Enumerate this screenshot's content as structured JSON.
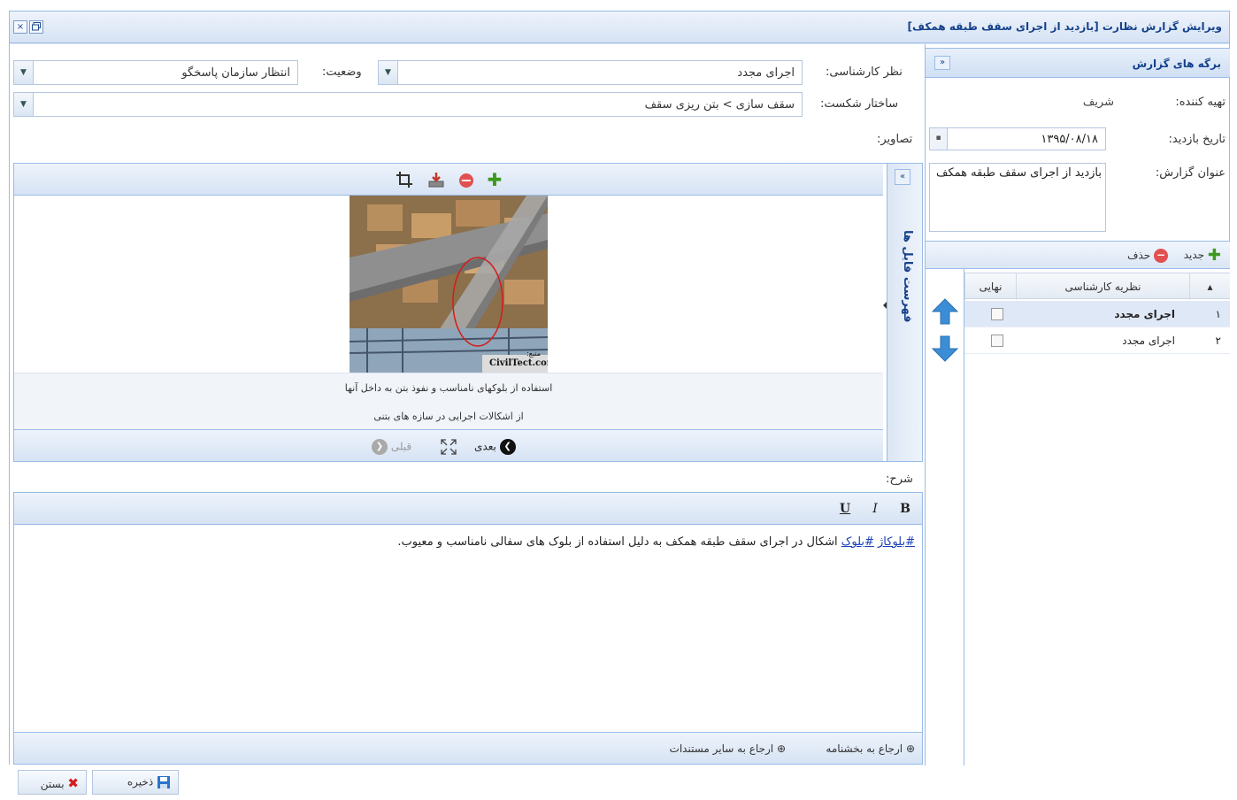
{
  "window": {
    "title": "ویرایش گزارش نظارت [بازدید از اجرای سقف طبقه همکف]",
    "close_icon": "×",
    "restore_icon": "restore-icon"
  },
  "right_panel": {
    "title": "برگه های گزارش",
    "collapse_glyph": "»",
    "fields": {
      "preparer_label": "تهیه کننده:",
      "preparer_value": "شریف",
      "visit_date_label": "تاریخ بازدید:",
      "visit_date_value": "۱۳۹۵/۰۸/۱۸",
      "report_title_label": "عنوان گزارش:",
      "report_title_value": "بازدید از اجرای سقف طبقه همکف"
    },
    "toolbar": {
      "new_label": "جدید",
      "delete_label": "حذف"
    },
    "grid": {
      "headers": {
        "num": "",
        "opinion": "نظریه کارشناسی",
        "final": "نهایی"
      },
      "rows": [
        {
          "num": "۱",
          "opinion": "اجرای مجدد",
          "final": false
        },
        {
          "num": "۲",
          "opinion": "اجرای مجدد",
          "final": false
        }
      ]
    }
  },
  "form": {
    "expert_opinion_label": "نظر کارشناسی:",
    "expert_opinion_value": "اجرای مجدد",
    "status_label": "وضعیت:",
    "status_value": "انتظار سازمان پاسخگو",
    "breakdown_label": "ساختار شکست:",
    "breakdown_value": "سقف سازی > بتن ریزی سقف",
    "images_label": "تصاویر:",
    "description_label": "شرح:"
  },
  "viewer": {
    "file_list_label": "فهرست فایل ها",
    "collapse_glyph": "«",
    "photo_watermark": "CivilTect.com",
    "photo_source": "منبع:",
    "caption_line1": "استفاده از بلوکهای نامناسب و نفوذ بتن به داخل آنها",
    "caption_line2": "از اشکالات اجرایی در سازه های بتنی",
    "next_label": "بعدی",
    "prev_label": "قبلی"
  },
  "editor": {
    "bold": "B",
    "italic": "I",
    "underline": "U",
    "tag1": "#بلوکاژ",
    "tag2": "#بلوک",
    "body_text": "اشکال در اجرای سقف طبقه همکف به دلیل استفاده از بلوک های سفالی نامناسب و معیوب.",
    "ref_notice": "ارجاع به بخشنامه",
    "ref_docs": "ارجاع به سایر مستندات"
  },
  "buttons": {
    "save_label": "ذخیره",
    "close_label": "بستن"
  },
  "colors": {
    "header_text": "#15428b",
    "panel_border": "#99bbe8",
    "panel_bg": "#dfe8f6"
  }
}
